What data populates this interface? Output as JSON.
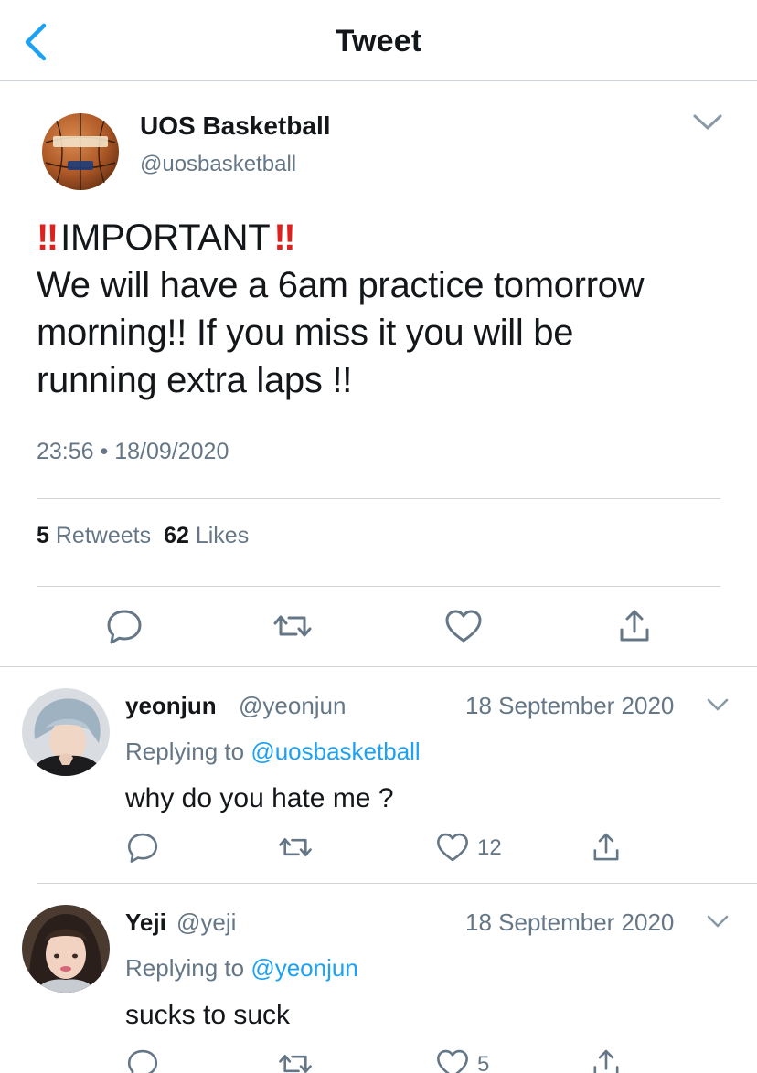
{
  "header": {
    "title": "Tweet",
    "back_icon": "chevron-left-icon",
    "accent": "#1da1f2"
  },
  "tweet": {
    "author_name": "UOS Basketball",
    "author_handle": "@uosbasketball",
    "emphasis_mark": "‼",
    "headline": "IMPORTANT",
    "lines": [
      "We will have a 6am practice tomorrow",
      "morning!! If you miss it you will be",
      "running extra laps !!"
    ],
    "time": "23:56",
    "separator": "•",
    "date": "18/09/2020",
    "retweets_count": "5",
    "retweets_label": "Retweets",
    "likes_count": "62",
    "likes_label": "Likes",
    "emphasis_color": "#e0201c"
  },
  "replies": [
    {
      "name": "yeonjun",
      "handle": "@yeonjun",
      "date": "18 September 2020",
      "replying_prefix": "Replying to",
      "replying_to": "@uosbasketball",
      "text": "why do you hate me ?",
      "likes": "12"
    },
    {
      "name": "Yeji",
      "handle": "@yeji",
      "date": "18 September 2020",
      "replying_prefix": "Replying to",
      "replying_to": "@yeonjun",
      "text": "sucks to suck",
      "likes": "5"
    }
  ]
}
